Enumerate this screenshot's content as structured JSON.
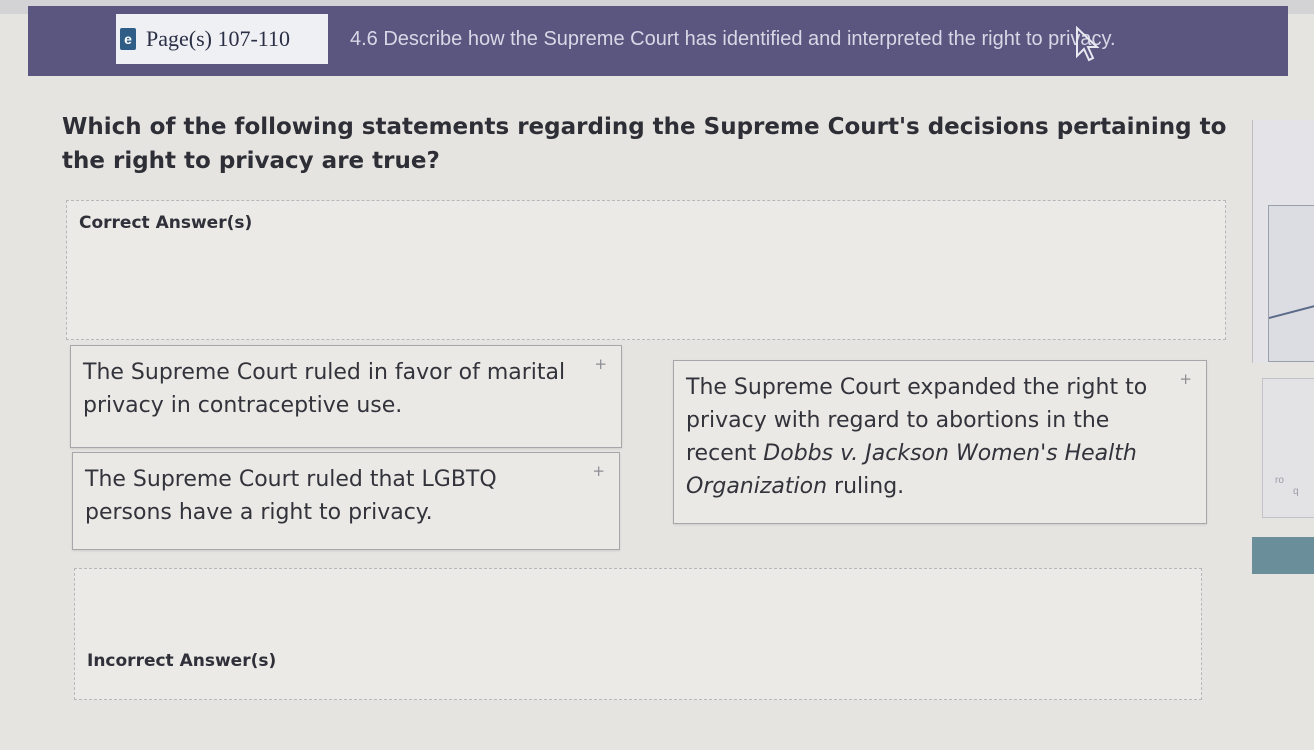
{
  "header": {
    "page_tab_icon": "book-icon",
    "page_tab_label": "Page(s) 107-110",
    "objective": "4.6 Describe how the Supreme Court has identified and interpreted the right to privacy."
  },
  "question": {
    "text": "Which of the following statements regarding the Supreme Court's decisions pertaining to the right to privacy are true?"
  },
  "correct_zone": {
    "label": "Correct Answer(s)"
  },
  "incorrect_zone": {
    "label": "Incorrect Answer(s)"
  },
  "cards": [
    {
      "text": "The Supreme Court ruled in favor of marital privacy in contraceptive use.",
      "handle": "+"
    },
    {
      "text": "The Supreme Court ruled that LGBTQ persons have a right to privacy.",
      "handle": "+"
    },
    {
      "text_before": "The Supreme Court expanded the right to privacy with regard to abortions in the recent",
      "case_name": "Dobbs v. Jackson Women's Health Organization",
      "text_after": " ruling.",
      "handle": "+"
    }
  ],
  "side_fragments": {
    "text_1": "ro",
    "text_2": "q"
  },
  "colors": {
    "header": "#5a5680",
    "background": "#e6e4e0",
    "card_border": "#a6a6ab",
    "teal": "#6b8f9a"
  }
}
